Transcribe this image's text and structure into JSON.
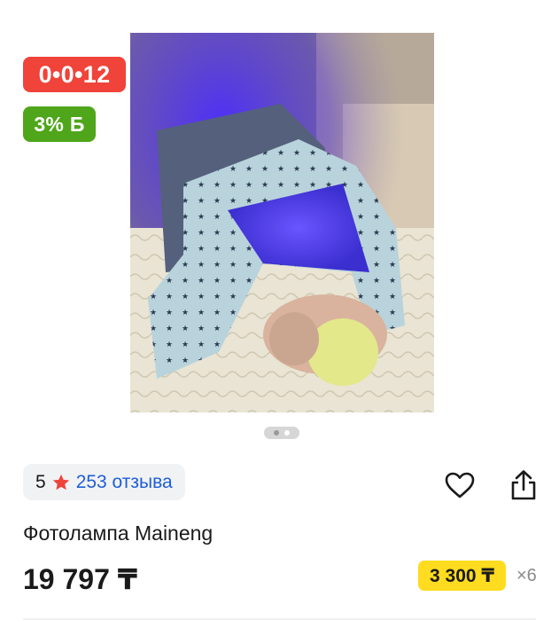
{
  "product": {
    "image_alt": "Newborn under phototherapy lamp",
    "timer_badge": "0•0•12",
    "bonus_badge": "3% Б",
    "gallery": {
      "total": 2,
      "active_index": 1
    },
    "rating_score": "5",
    "reviews_label": "253 отзыва",
    "title": "Фотолампа Maineng",
    "price": "19 797 ₸",
    "installment_amount": "3 300 ₸",
    "installment_months": "×6"
  },
  "icons": {
    "rating": "star-icon",
    "favorite": "heart-icon",
    "share": "share-icon"
  },
  "colors": {
    "timer_badge_bg": "#f0433a",
    "bonus_badge_bg": "#4fa61b",
    "star": "#f0433a",
    "reviews_link": "#1e5fd6",
    "installment_bg": "#ffdc1f"
  }
}
